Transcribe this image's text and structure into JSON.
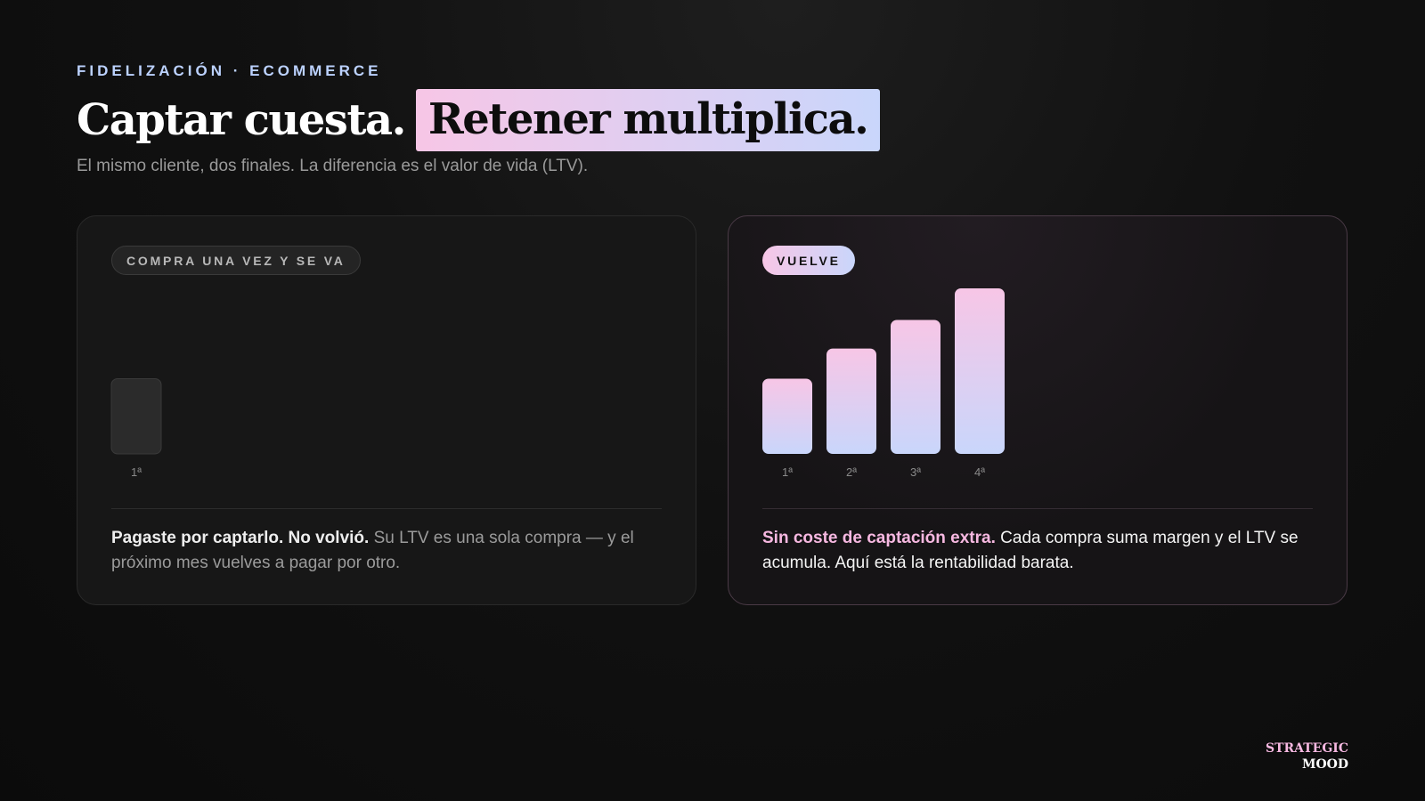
{
  "header": {
    "eyebrow": "FIDELIZACIÓN · ECOMMERCE",
    "title_plain": "Captar cuesta.",
    "title_highlight": "Retener multiplica.",
    "subtitle": "El mismo cliente, dos finales. La diferencia es el valor de vida (LTV)."
  },
  "cards": {
    "left": {
      "badge": "COMPRA UNA VEZ Y SE VA",
      "desc_lead": "Pagaste por captarlo. No volvió.",
      "desc_rest": " Su LTV es una sola compra — y el próximo mes vuelves a pagar por otro."
    },
    "right": {
      "badge": "VUELVE",
      "desc_lead": "Sin coste de captación extra.",
      "desc_rest": " Cada compra suma margen y el LTV se acumula. Aquí está la rentabilidad barata."
    }
  },
  "brand": {
    "line1": "STRATEGIC",
    "line2": "MOOD"
  },
  "colors": {
    "accent_pink": "#f7c6e6",
    "accent_blue": "#c9d6fb",
    "muted_bar": "#2b2b2b"
  },
  "chart_data": [
    {
      "type": "bar",
      "categories": [
        "1ª"
      ],
      "values": [
        1
      ],
      "ylim": [
        0,
        2.2
      ],
      "style": "muted"
    },
    {
      "type": "bar",
      "categories": [
        "1ª",
        "2ª",
        "3ª",
        "4ª"
      ],
      "values": [
        1,
        1.4,
        1.78,
        2.2
      ],
      "ylim": [
        0,
        2.2
      ],
      "style": "gradient"
    }
  ]
}
